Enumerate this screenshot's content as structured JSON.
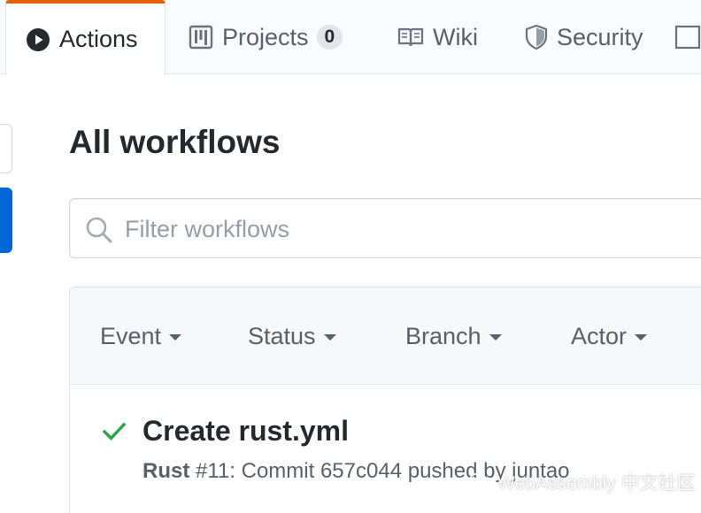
{
  "tabs": [
    {
      "label": "Actions",
      "icon": "play-icon",
      "selected": true
    },
    {
      "label": "Projects",
      "icon": "project-icon",
      "counter": "0"
    },
    {
      "label": "Wiki",
      "icon": "book-icon"
    },
    {
      "label": "Security",
      "icon": "shield-icon"
    }
  ],
  "page": {
    "title": "All workflows"
  },
  "search": {
    "placeholder": "Filter workflows",
    "value": ""
  },
  "filters": {
    "event": "Event",
    "status": "Status",
    "branch": "Branch",
    "actor": "Actor"
  },
  "runs": [
    {
      "status": "success",
      "title": "Create rust.yml",
      "workflow": "Rust",
      "number": "#11",
      "prefix": ": Commit ",
      "commit": "657c044",
      "pushed_by": " pushed by ",
      "actor": "juntao"
    }
  ],
  "watermark": {
    "text": "WebAssembly 中文社区"
  },
  "colors": {
    "accent_tab": "#e36209",
    "success": "#28a745",
    "primary": "#0366d6"
  }
}
